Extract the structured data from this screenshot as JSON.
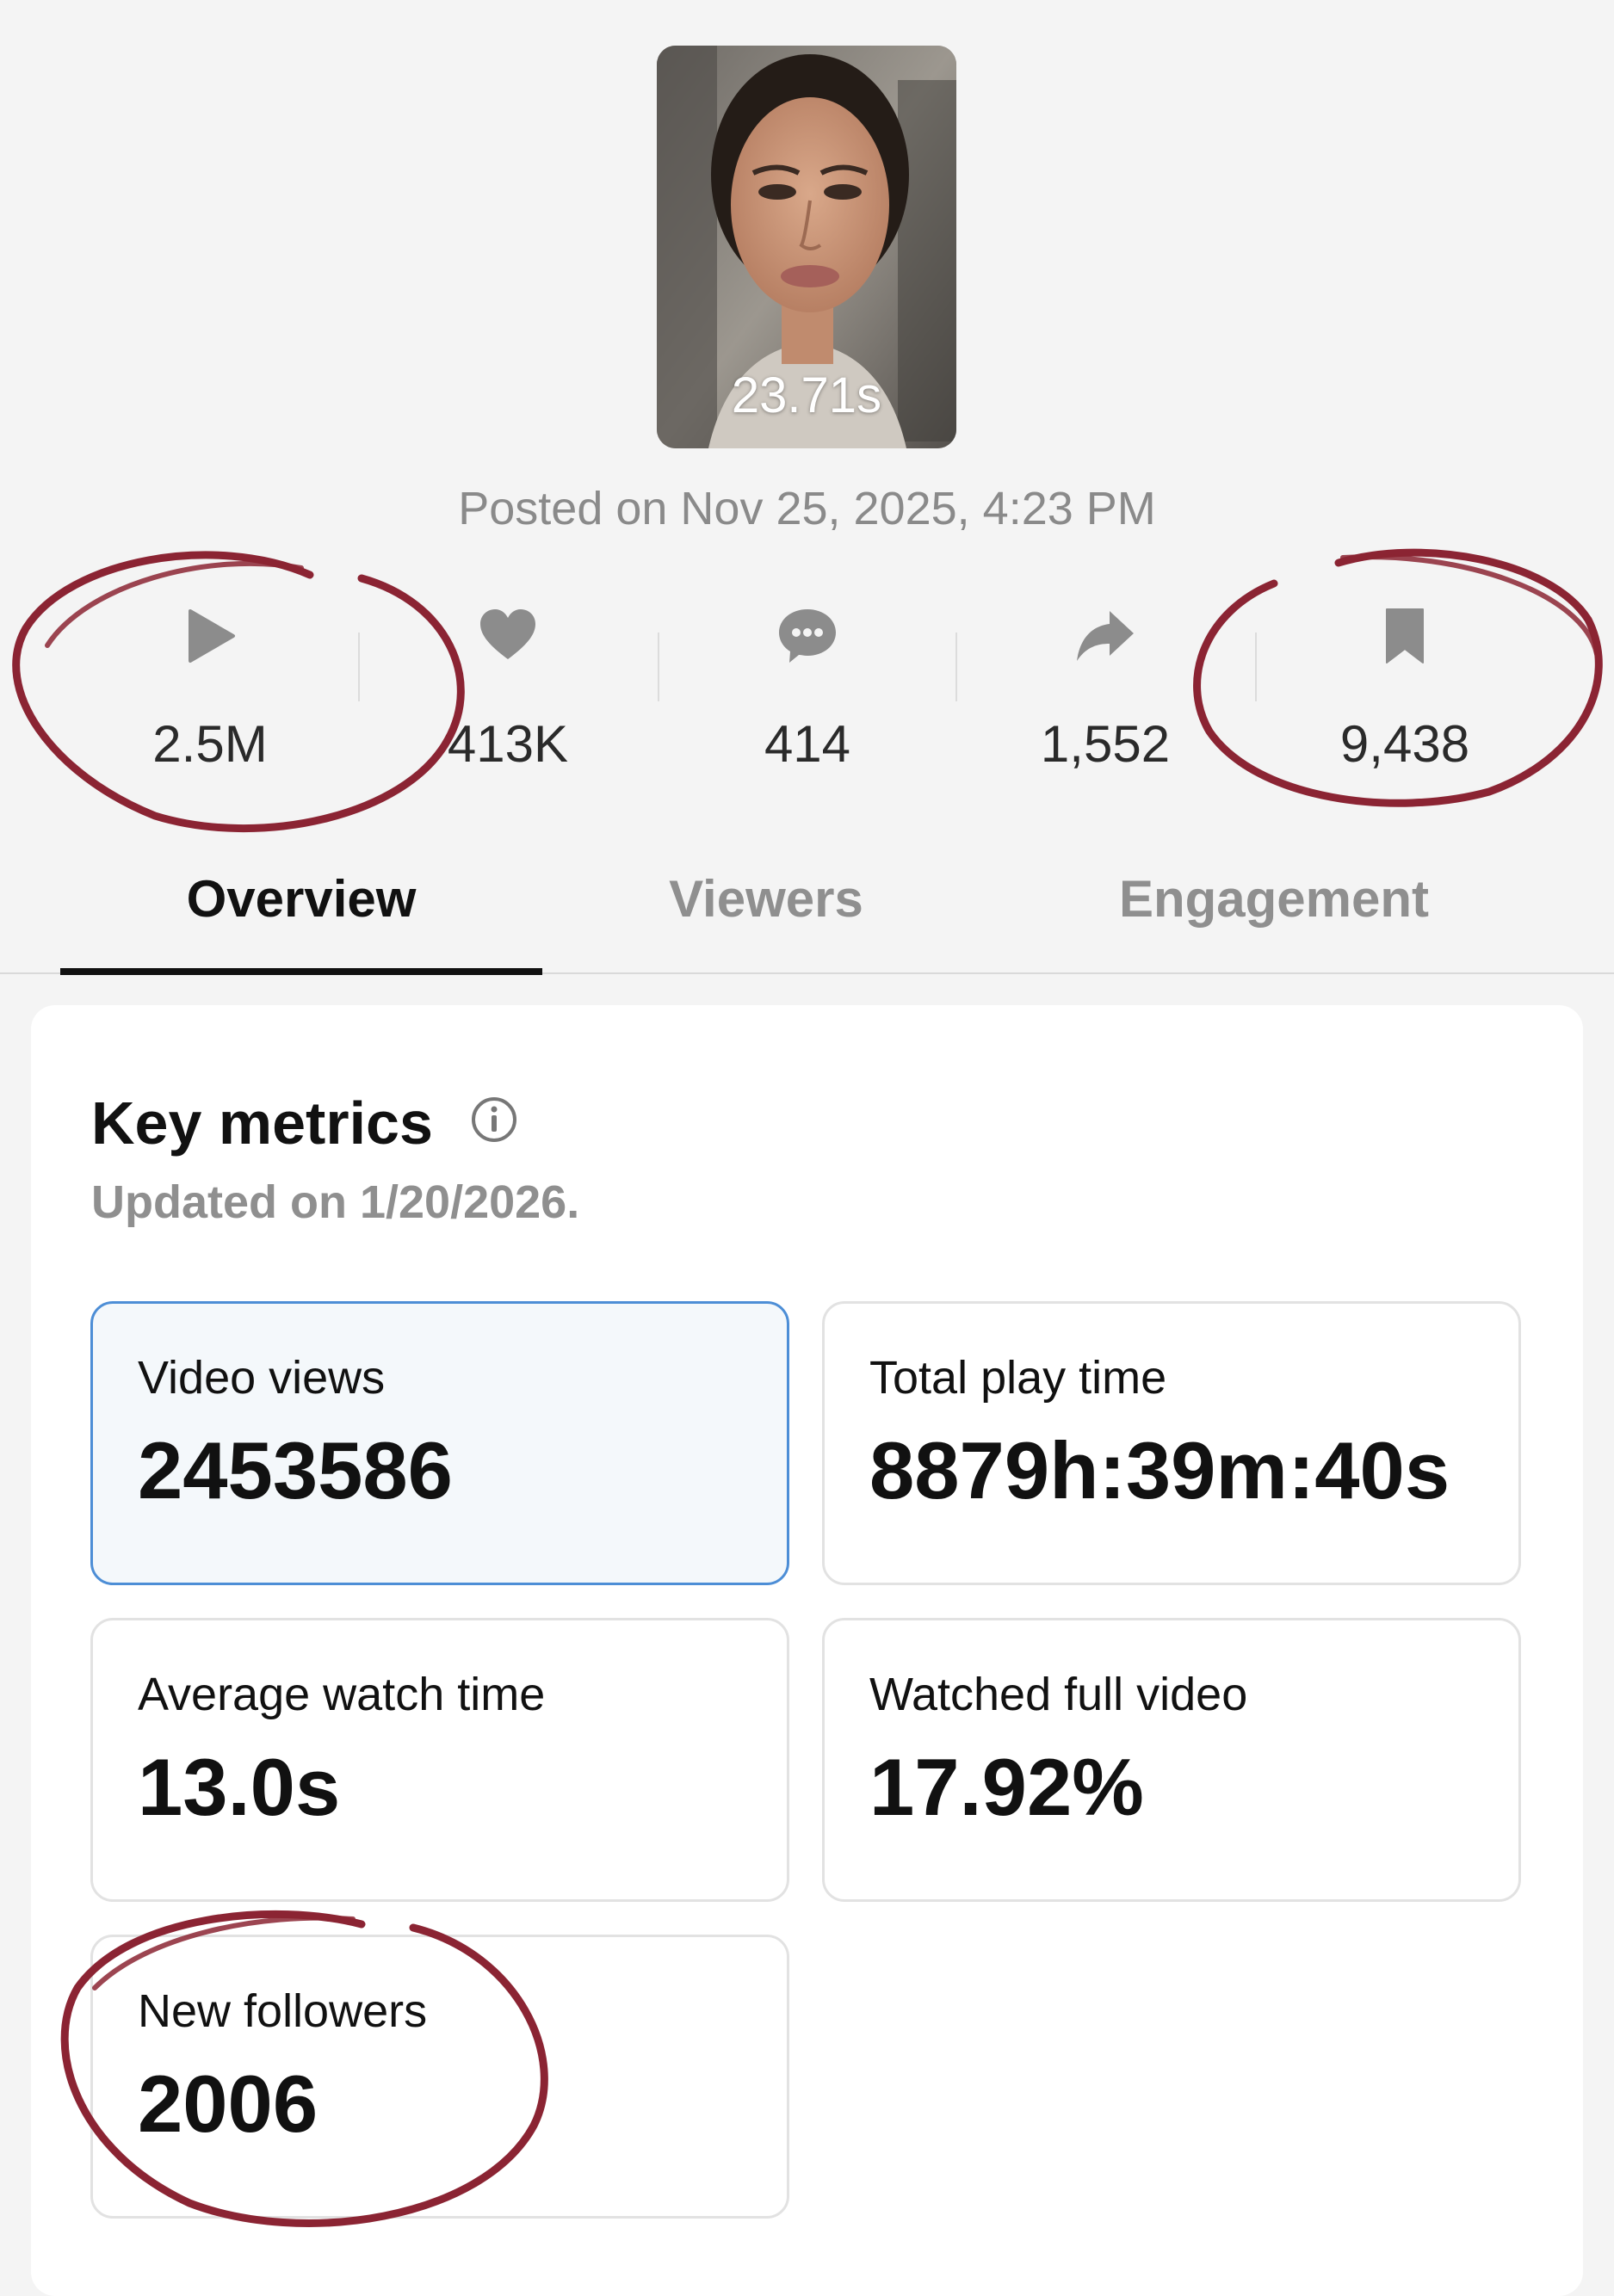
{
  "video": {
    "duration": "23.71s",
    "posted": "Posted on Nov 25, 2025, 4:23 PM"
  },
  "stats": [
    {
      "icon": "play-icon",
      "value": "2.5M"
    },
    {
      "icon": "heart-icon",
      "value": "413K"
    },
    {
      "icon": "comment-icon",
      "value": "414"
    },
    {
      "icon": "share-icon",
      "value": "1,552"
    },
    {
      "icon": "bookmark-icon",
      "value": "9,438"
    }
  ],
  "tabs": [
    {
      "label": "Overview",
      "active": true
    },
    {
      "label": "Viewers",
      "active": false
    },
    {
      "label": "Engagement",
      "active": false
    }
  ],
  "key_metrics": {
    "title": "Key metrics",
    "updated": "Updated on 1/20/2026.",
    "items": [
      {
        "label": "Video views",
        "value": "2453586",
        "selected": true
      },
      {
        "label": "Total play time",
        "value": "8879h:39m:40s",
        "selected": false
      },
      {
        "label": "Average watch time",
        "value": "13.0s",
        "selected": false
      },
      {
        "label": "Watched full video",
        "value": "17.92%",
        "selected": false
      },
      {
        "label": "New followers",
        "value": "2006",
        "selected": false
      }
    ]
  },
  "colors": {
    "annotation": "#8b2433",
    "selected_border": "#4d8ed6",
    "icon_gray": "#8c8c8c"
  }
}
